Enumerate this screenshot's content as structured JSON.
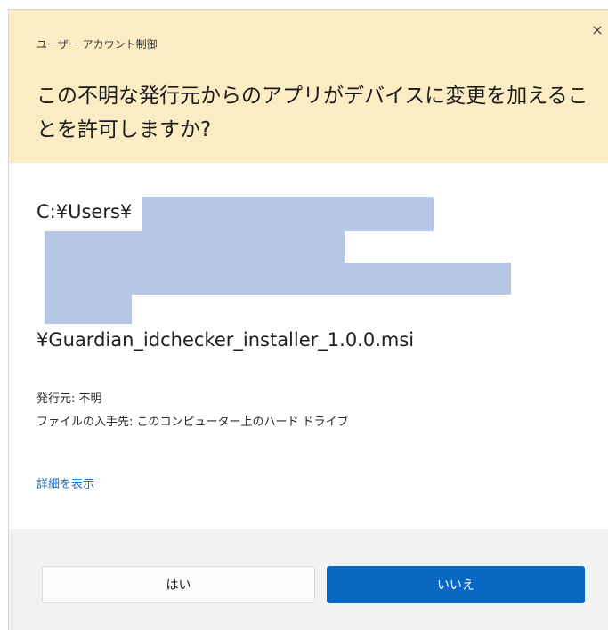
{
  "dialog": {
    "caption": "ユーザー アカウント制御",
    "close_symbol": "×",
    "question": "この不明な発行元からのアプリがデバイスに変更を加えることを許可しますか?"
  },
  "program": {
    "path_prefix": "C:¥Users¥",
    "file_name": "¥Guardian_idchecker_installer_1.0.0.msi"
  },
  "info": {
    "publisher": "発行元: 不明",
    "origin": "ファイルの入手先: このコンピューター上のハード ドライブ"
  },
  "details_link": "詳細を表示",
  "buttons": {
    "yes": "はい",
    "no": "いいえ"
  },
  "colors": {
    "header_bg": "#fcecc4",
    "accent": "#0a67c2",
    "redaction": "#b7c6e4",
    "footer_bg": "#f2f2f2"
  }
}
